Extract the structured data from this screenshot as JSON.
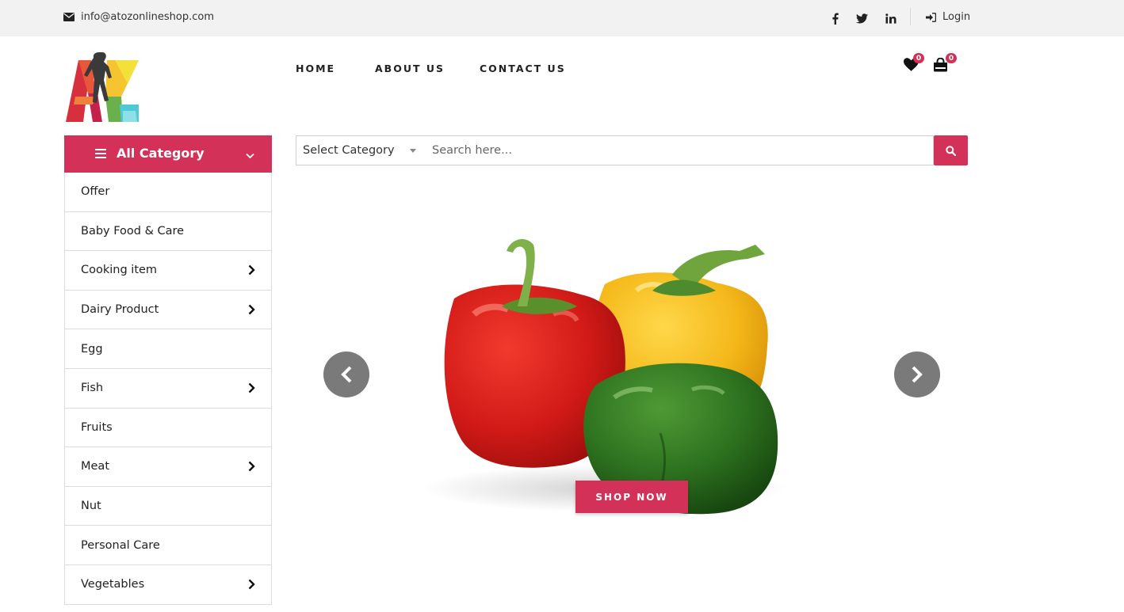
{
  "topbar": {
    "email": "info@atozonlineshop.com",
    "social": [
      {
        "icon": "facebook-icon",
        "glyph": "f"
      },
      {
        "icon": "twitter-icon",
        "glyph": "t"
      },
      {
        "icon": "linkedin-icon",
        "glyph": "in"
      }
    ],
    "login_label": "Login"
  },
  "nav": {
    "items": [
      "HOME",
      "ABOUT US",
      "CONTACT US"
    ]
  },
  "header_icons": {
    "wishlist_count": "0",
    "cart_count": "0"
  },
  "category": {
    "title": "All Category",
    "items": [
      {
        "label": "Offer",
        "has_submenu": false
      },
      {
        "label": "Baby Food & Care",
        "has_submenu": false
      },
      {
        "label": "Cooking item",
        "has_submenu": true
      },
      {
        "label": "Dairy Product",
        "has_submenu": true
      },
      {
        "label": "Egg",
        "has_submenu": false
      },
      {
        "label": "Fish",
        "has_submenu": true
      },
      {
        "label": "Fruits",
        "has_submenu": false
      },
      {
        "label": "Meat",
        "has_submenu": true
      },
      {
        "label": "Nut",
        "has_submenu": false
      },
      {
        "label": "Personal Care",
        "has_submenu": false
      },
      {
        "label": "Vegetables",
        "has_submenu": true
      }
    ]
  },
  "search": {
    "category_selected": "Select Category",
    "placeholder": "Search here..."
  },
  "slider": {
    "cta_label": "SHOP NOW"
  },
  "colors": {
    "accent": "#d33158",
    "topbar_bg": "#f2f2f2",
    "slider_nav_bg": "#7a7a7a"
  }
}
